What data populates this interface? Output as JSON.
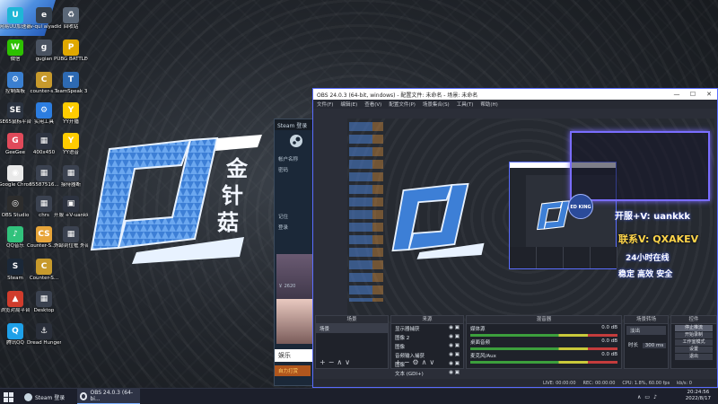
{
  "desktop_icons": [
    {
      "label": "网易UU加速器",
      "color": "#1fb6d6",
      "glyph": "U"
    },
    {
      "label": "ev-qui\naiyadidas",
      "color": "#35404c",
      "glyph": "e"
    },
    {
      "label": "回收站",
      "color": "#5a6777",
      "glyph": "♻"
    },
    {
      "label": "微信",
      "color": "#2dc100",
      "glyph": "W"
    },
    {
      "label": "gugian",
      "color": "#4a5361",
      "glyph": "g"
    },
    {
      "label": "PUBG BATTLEGR...",
      "color": "#e0a800",
      "glyph": "P"
    },
    {
      "label": "控制面板",
      "color": "#3a7fd0",
      "glyph": "⚙"
    },
    {
      "label": "counter-s...",
      "color": "#c79a2c",
      "glyph": "C"
    },
    {
      "label": "TeamSpeak 3",
      "color": "#2d6ab3",
      "glyph": "T"
    },
    {
      "label": "SE65鼠标平台",
      "color": "#2b3340",
      "glyph": "SE"
    },
    {
      "label": "实用工具",
      "color": "#2c7de0",
      "glyph": "⚙"
    },
    {
      "label": "YY开播",
      "color": "#ffcc00",
      "glyph": "Y"
    },
    {
      "label": "GeeGee",
      "color": "#e04a5a",
      "glyph": "G"
    },
    {
      "label": "400x450",
      "color": "#2d3340",
      "glyph": "▦"
    },
    {
      "label": "YY语音",
      "color": "#ffcc00",
      "glyph": "Y"
    },
    {
      "label": "Google Chrome",
      "color": "#e9e9e9",
      "glyph": "◉"
    },
    {
      "label": "65587516...",
      "color": "#3b4250",
      "glyph": "▦"
    },
    {
      "label": "接待器断",
      "color": "#3b4250",
      "glyph": "▦"
    },
    {
      "label": "OBS Studio",
      "color": "#2d2d2d",
      "glyph": "◎"
    },
    {
      "label": "chrs",
      "color": "#3b4250",
      "glyph": "▦"
    },
    {
      "label": "开服\n+V-uankk...",
      "color": "#2d3340",
      "glyph": "▣"
    },
    {
      "label": "QQ音乐",
      "color": "#31c27c",
      "glyph": "♪"
    },
    {
      "label": "Counter-S... Global Off...",
      "color": "#e7a53a",
      "glyph": "CS"
    },
    {
      "label": "外部到位框\n外部文件",
      "color": "#3b4250",
      "glyph": "▦"
    },
    {
      "label": "Steam",
      "color": "#1b2838",
      "glyph": "S"
    },
    {
      "label": "Counter-S...",
      "color": "#c79a2c",
      "glyph": "C"
    },
    {
      "label": "浏览对局平台",
      "color": "#d03c2c",
      "glyph": "▲"
    },
    {
      "label": "Desktop",
      "color": "#3b4250",
      "glyph": "▦"
    },
    {
      "label": "腾讯QQ",
      "color": "#1ea0e8",
      "glyph": "Q"
    },
    {
      "label": "Dread Hunger",
      "color": "#2a2f3a",
      "glyph": "⚓"
    }
  ],
  "logo_chars": [
    "金",
    "针",
    "菇"
  ],
  "steam_window": {
    "title": "Steam 登录",
    "items": [
      "帐户名称",
      "密码",
      "记住",
      "登录"
    ],
    "price": "￥ 2620",
    "footer_label": "娱乐",
    "footer_tag": "自力打赏"
  },
  "obs": {
    "title": "OBS 24.0.3 (64-bit, windows) - 配置文件: 未命名 - 场景: 未命名",
    "menu": [
      "文件(F)",
      "编辑(E)",
      "查看(V)",
      "配置文件(P)",
      "场景集合(S)",
      "工具(T)",
      "帮助(H)"
    ],
    "overlay": {
      "line1": "开服+V: uankkk",
      "line2": "联系V: QXAKEV",
      "line3": "24小时在线",
      "line4": "稳定 高效 安全",
      "small": "ED KING"
    },
    "panels": {
      "scenes": {
        "header": "场景",
        "items": [
          "场景"
        ]
      },
      "sources": {
        "header": "来源",
        "items": [
          "显示器捕获",
          "图像 2",
          "图像",
          "音频输入捕获",
          "图像",
          "文本 (GDI+)"
        ]
      },
      "mixer": {
        "header": "混音器",
        "items": [
          "媒体源",
          "桌面音频",
          "麦克风/Aux"
        ],
        "db": [
          "0.0 dB",
          "0.0 dB",
          "0.0 dB"
        ]
      },
      "transitions": {
        "header": "场景转场",
        "mode": "淡出",
        "duration_label": "时长",
        "duration": "300 ms"
      },
      "controls": {
        "header": "控件",
        "buttons": [
          "停止推流",
          "开始录制",
          "工作室模式",
          "设置",
          "退出"
        ]
      }
    },
    "status": {
      "live": "LIVE: 00:00:00",
      "rec": "REC: 00:00:00",
      "cpu": "CPU: 1.8%, 60.00 fps",
      "kbps": "kb/s: 0"
    }
  },
  "taskbar": {
    "items": [
      {
        "label": "Steam 登录"
      },
      {
        "label": "OBS 24.0.3 (64-bi..."
      }
    ],
    "time": "20:24:56",
    "date": "2022/8/17"
  }
}
